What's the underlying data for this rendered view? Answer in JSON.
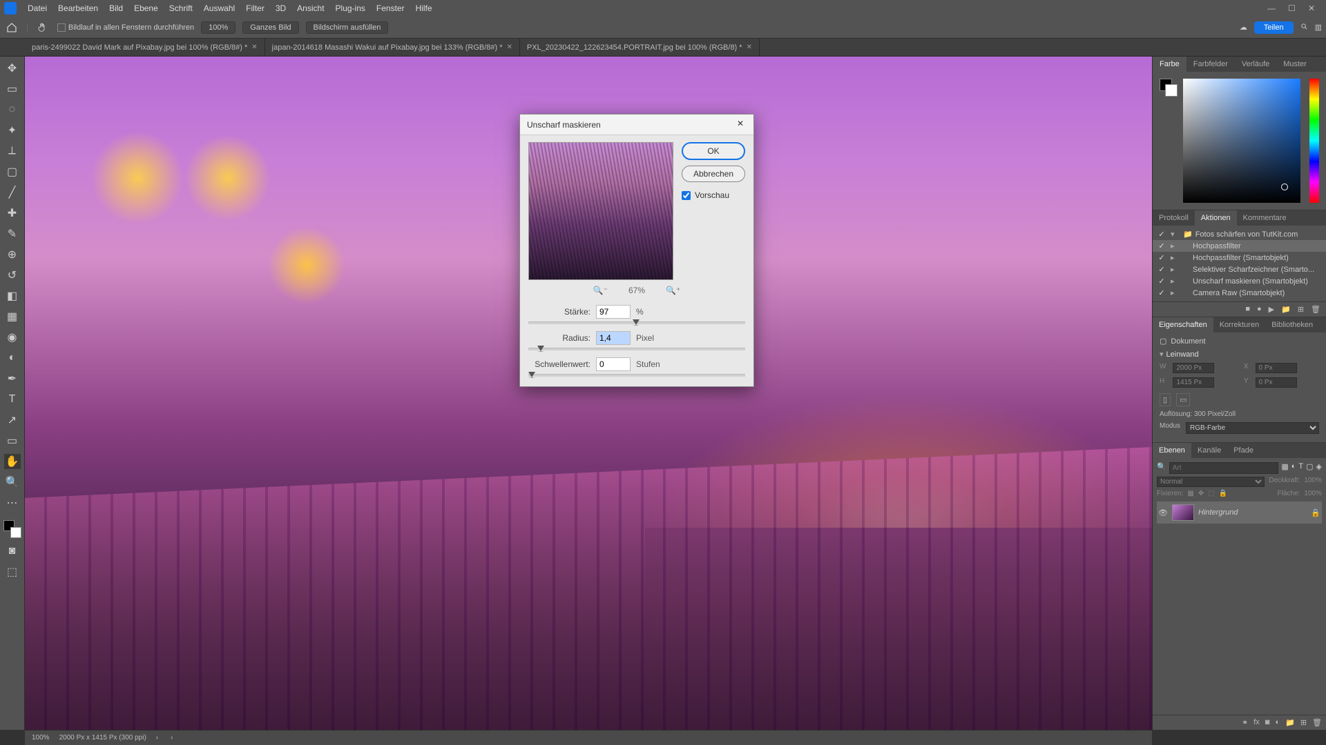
{
  "menu": {
    "items": [
      "Datei",
      "Bearbeiten",
      "Bild",
      "Ebene",
      "Schrift",
      "Auswahl",
      "Filter",
      "3D",
      "Ansicht",
      "Plug-ins",
      "Fenster",
      "Hilfe"
    ]
  },
  "optbar": {
    "scroll_all": "Bildlauf in allen Fenstern durchführen",
    "zoom": "100%",
    "fit": "Ganzes Bild",
    "fill": "Bildschirm ausfüllen",
    "share": "Teilen"
  },
  "tabs": [
    "paris-2499022  David Mark auf Pixabay.jpg bei 100% (RGB/8#) *",
    "japan-2014618 Masashi Wakui auf Pixabay.jpg bei 133% (RGB/8#) *",
    "PXL_20230422_122623454.PORTRAIT.jpg bei 100% (RGB/8) *"
  ],
  "status": {
    "zoom": "100%",
    "doc": "2000 Px x 1415 Px (300 ppi)"
  },
  "panels": {
    "color_tabs": [
      "Farbe",
      "Farbfelder",
      "Verläufe",
      "Muster"
    ],
    "actions": {
      "tabs": [
        "Protokoll",
        "Aktionen",
        "Kommentare"
      ],
      "set": "Fotos schärfen von TutKit.com",
      "items": [
        "Hochpassfilter",
        "Hochpassfilter (Smartobjekt)",
        "Selektiver Scharfzeichner (Smarto...",
        "Unscharf maskieren (Smartobjekt)",
        "Camera Raw (Smartobjekt)"
      ]
    },
    "properties": {
      "tabs": [
        "Eigenschaften",
        "Korrekturen",
        "Bibliotheken"
      ],
      "doc_label": "Dokument",
      "canvas_label": "Leinwand",
      "w": "2000 Px",
      "h": "1415 Px",
      "x": "0 Px",
      "y": "0 Px",
      "res": "Auflösung: 300 Pixel/Zoll",
      "mode_label": "Modus",
      "mode": "RGB-Farbe"
    },
    "layers": {
      "tabs": [
        "Ebenen",
        "Kanäle",
        "Pfade"
      ],
      "search_ph": "Art",
      "blend": "Normal",
      "opacity_label": "Deckkraft:",
      "opacity": "100%",
      "lock_label": "Fixieren:",
      "fill_label": "Fläche:",
      "fill": "100%",
      "bg": "Hintergrund"
    }
  },
  "dialog": {
    "title": "Unscharf maskieren",
    "ok": "OK",
    "cancel": "Abbrechen",
    "preview": "Vorschau",
    "zoom": "67%",
    "amount_label": "Stärke:",
    "amount": "97",
    "amount_unit": "%",
    "radius_label": "Radius:",
    "radius": "1,4",
    "radius_unit": "Pixel",
    "thresh_label": "Schwellenwert:",
    "thresh": "0",
    "thresh_unit": "Stufen"
  }
}
